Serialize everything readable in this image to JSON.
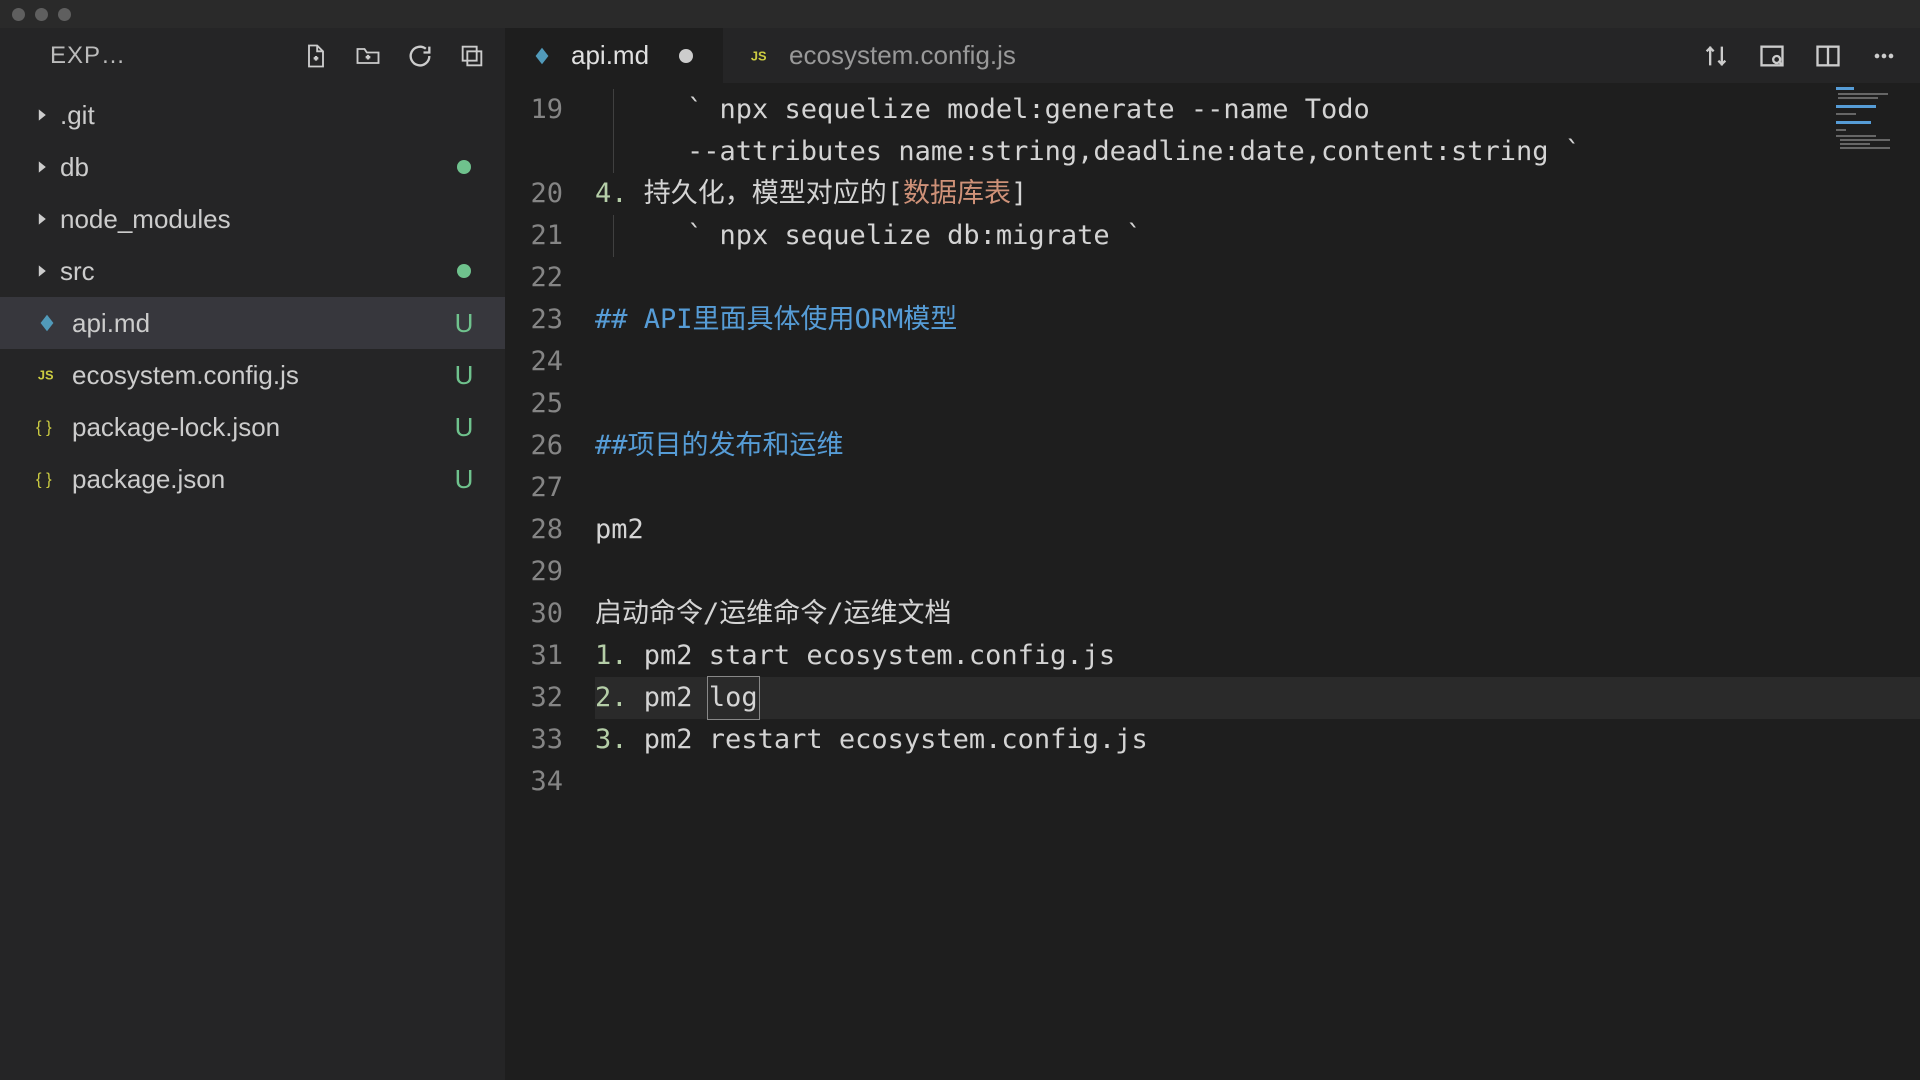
{
  "titlebar": {
    "buttons": [
      "close",
      "minimize",
      "zoom"
    ]
  },
  "sidebar": {
    "title": "EXP…",
    "actions": [
      "new-file",
      "new-folder",
      "refresh",
      "collapse-all"
    ],
    "items": [
      {
        "name": ".git",
        "type": "folder",
        "chevron": true
      },
      {
        "name": "db",
        "type": "folder",
        "chevron": true,
        "modified": true
      },
      {
        "name": "node_modules",
        "type": "folder",
        "chevron": true
      },
      {
        "name": "src",
        "type": "folder",
        "chevron": true,
        "modified": true
      },
      {
        "name": "api.md",
        "type": "md",
        "status": "U",
        "active": true
      },
      {
        "name": "ecosystem.config.js",
        "type": "js",
        "status": "U"
      },
      {
        "name": "package-lock.json",
        "type": "json",
        "status": "U"
      },
      {
        "name": "package.json",
        "type": "json",
        "status": "U"
      }
    ]
  },
  "tabs": [
    {
      "name": "api.md",
      "type": "md",
      "active": true,
      "modified": true
    },
    {
      "name": "ecosystem.config.js",
      "type": "js",
      "active": false
    }
  ],
  "tab_actions": [
    "compare",
    "preview",
    "split",
    "more"
  ],
  "editor": {
    "first_line_number": 19,
    "cursor_line": 32,
    "lines": [
      {
        "n": 19,
        "indent": 2,
        "segs": [
          {
            "t": "` ",
            "c": "back"
          },
          {
            "t": "npx sequelize model:generate --name Todo",
            "c": "cmd"
          }
        ]
      },
      {
        "n": null,
        "indent": 2,
        "segs": [
          {
            "t": "--attributes name:string,deadline:date,content:string ",
            "c": "cmd"
          },
          {
            "t": "`",
            "c": "back"
          }
        ]
      },
      {
        "n": 20,
        "indent": 0,
        "segs": [
          {
            "t": "4. ",
            "c": "num"
          },
          {
            "t": "持久化，模型对应的[",
            "c": "txt"
          },
          {
            "t": "数据库表",
            "c": "link"
          },
          {
            "t": "]",
            "c": "txt"
          }
        ]
      },
      {
        "n": 21,
        "indent": 2,
        "segs": [
          {
            "t": "` ",
            "c": "back"
          },
          {
            "t": "npx sequelize db:migrate",
            "c": "cmd"
          },
          {
            "t": " `",
            "c": "back"
          }
        ]
      },
      {
        "n": 22,
        "indent": 0,
        "segs": []
      },
      {
        "n": 23,
        "indent": 0,
        "segs": [
          {
            "t": "## API里面具体使用ORM模型",
            "c": "head"
          }
        ]
      },
      {
        "n": 24,
        "indent": 0,
        "segs": []
      },
      {
        "n": 25,
        "indent": 0,
        "segs": []
      },
      {
        "n": 26,
        "indent": 0,
        "segs": [
          {
            "t": "##项目的发布和运维",
            "c": "head"
          }
        ]
      },
      {
        "n": 27,
        "indent": 0,
        "segs": []
      },
      {
        "n": 28,
        "indent": 0,
        "segs": [
          {
            "t": "pm2",
            "c": "txt"
          }
        ]
      },
      {
        "n": 29,
        "indent": 0,
        "segs": []
      },
      {
        "n": 30,
        "indent": 0,
        "segs": [
          {
            "t": "启动命令/运维命令/运维文档",
            "c": "txt"
          }
        ]
      },
      {
        "n": 31,
        "indent": 0,
        "segs": [
          {
            "t": "1. ",
            "c": "num"
          },
          {
            "t": "pm2 start ecosystem.config.js",
            "c": "cmd"
          }
        ]
      },
      {
        "n": 32,
        "indent": 0,
        "hl": true,
        "segs": [
          {
            "t": "2. ",
            "c": "num"
          },
          {
            "t": "pm2 ",
            "c": "cmd"
          },
          {
            "t": "log",
            "c": "cmd",
            "boxed": true
          }
        ],
        "text_cursor_after": true
      },
      {
        "n": 33,
        "indent": 0,
        "segs": [
          {
            "t": "3. ",
            "c": "num"
          },
          {
            "t": "pm2 restart ecosystem.config.js",
            "c": "cmd"
          }
        ]
      },
      {
        "n": 34,
        "indent": 0,
        "segs": []
      }
    ]
  }
}
